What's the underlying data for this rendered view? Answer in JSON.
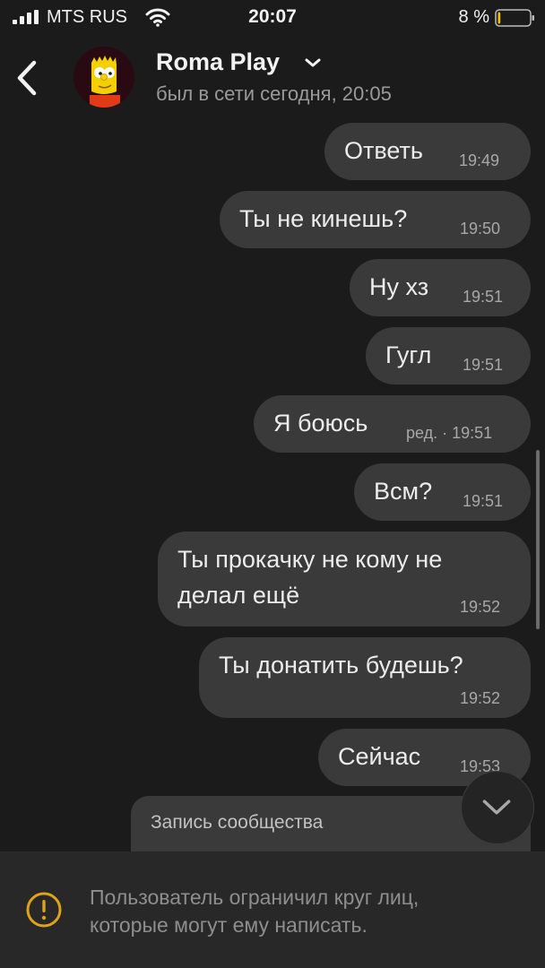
{
  "status_bar": {
    "carrier": "MTS RUS",
    "time": "20:07",
    "battery_percent": "8 %",
    "battery_level": 0.08
  },
  "header": {
    "name": "Roma Play",
    "last_seen": "был в сети сегодня, 20:05",
    "avatar_icon": "cartoon-avatar"
  },
  "messages": [
    {
      "text": "Ответь",
      "time": "19:49"
    },
    {
      "text": "Ты не кинешь?",
      "time": "19:50"
    },
    {
      "text": "Ну хз",
      "time": "19:51"
    },
    {
      "text": "Гугл",
      "time": "19:51"
    },
    {
      "text": "Я боюсь",
      "time": "ред. · 19:51"
    },
    {
      "text": "Всм?",
      "time": "19:51"
    },
    {
      "text_line1": "Ты прокачку не кому не",
      "text_line2": "делал ещё",
      "time": "19:52"
    },
    {
      "text": "Ты донатить будешь?",
      "time": "19:52"
    },
    {
      "text": "Сейчас",
      "time": "19:53"
    }
  ],
  "community_post": {
    "label": "Запись сообщества"
  },
  "restriction": {
    "line1": "Пользователь ограничил круг лиц,",
    "line2": "которые могут ему написать."
  },
  "colors": {
    "background": "#1b1b1b",
    "bubble": "#3a3a3a",
    "warning": "#e0a21b"
  }
}
